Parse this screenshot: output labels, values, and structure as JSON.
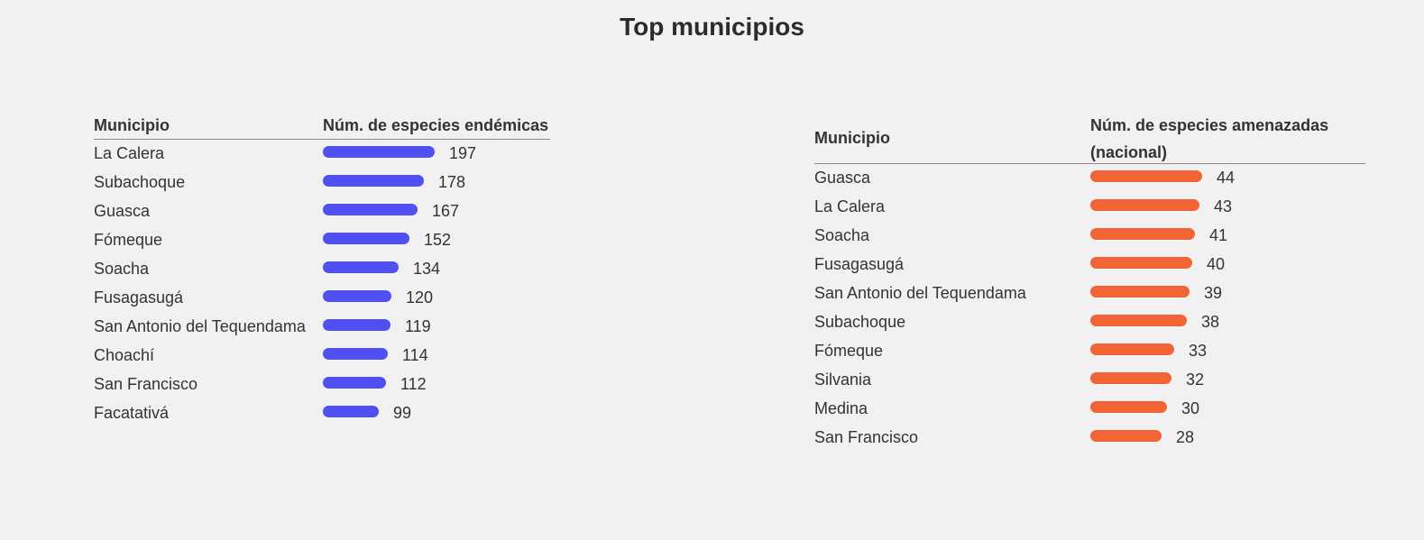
{
  "title": "Top municipios",
  "colors": {
    "endemic_bar": "#5050f0",
    "threatened_bar": "#f26433"
  },
  "chart_data": [
    {
      "type": "bar",
      "orientation": "horizontal",
      "headers": [
        "Municipio",
        "Núm. de especies endémicas"
      ],
      "categories": [
        "La Calera",
        "Subachoque",
        "Guasca",
        "Fómeque",
        "Soacha",
        "Fusagasugá",
        "San Antonio del Tequendama",
        "Choachí",
        "San Francisco",
        "Facatativá"
      ],
      "values": [
        197,
        178,
        167,
        152,
        134,
        120,
        119,
        114,
        112,
        99
      ],
      "xlim": [
        0,
        197
      ]
    },
    {
      "type": "bar",
      "orientation": "horizontal",
      "headers": [
        "Municipio",
        "Núm. de especies amenazadas (nacional)"
      ],
      "categories": [
        "Guasca",
        "La Calera",
        "Soacha",
        "Fusagasugá",
        "San Antonio del Tequendama",
        "Subachoque",
        "Fómeque",
        "Silvania",
        "Medina",
        "San Francisco"
      ],
      "values": [
        44,
        43,
        41,
        40,
        39,
        38,
        33,
        32,
        30,
        28
      ],
      "xlim": [
        0,
        44
      ]
    }
  ]
}
